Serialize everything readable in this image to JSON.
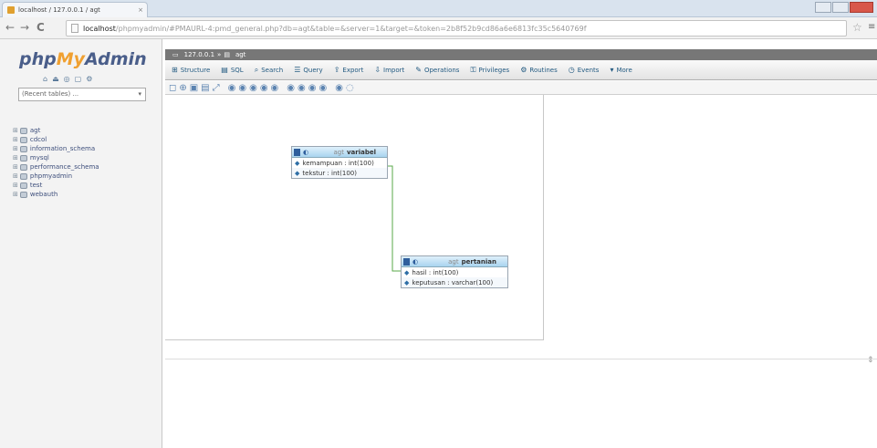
{
  "browser": {
    "tab_title": "localhost / 127.0.0.1 / agt",
    "tab_close": "×",
    "url_host": "localhost",
    "url_rest": "/phpmyadmin/#PMAURL-4:pmd_general.php?db=agt&table=&server=1&target=&token=2b8f52b9cd86a6e6813fc35c5640769f",
    "back": "←",
    "forward": "→",
    "reload": "C",
    "star": "☆",
    "menu": "≡"
  },
  "sidebar": {
    "logo_php": "php",
    "logo_my": "My",
    "logo_admin": "Admin",
    "quick_icons": [
      "home-icon",
      "exit-icon",
      "help-icon",
      "docs-icon",
      "settings-icon"
    ],
    "recent_label": "(Recent tables) ...",
    "databases": [
      {
        "label": "agt"
      },
      {
        "label": "cdcol"
      },
      {
        "label": "information_schema"
      },
      {
        "label": "mysql"
      },
      {
        "label": "performance_schema"
      },
      {
        "label": "phpmyadmin"
      },
      {
        "label": "test"
      },
      {
        "label": "webauth"
      }
    ]
  },
  "breadcrumb": {
    "server": "127.0.0.1",
    "database": "agt"
  },
  "top_menu": [
    {
      "label": "Structure",
      "icon": "structure-icon",
      "glyph": "⊞"
    },
    {
      "label": "SQL",
      "icon": "sql-icon",
      "glyph": "▤"
    },
    {
      "label": "Search",
      "icon": "search-icon",
      "glyph": "⌕"
    },
    {
      "label": "Query",
      "icon": "query-icon",
      "glyph": "☰"
    },
    {
      "label": "Export",
      "icon": "export-icon",
      "glyph": "⇪"
    },
    {
      "label": "Import",
      "icon": "import-icon",
      "glyph": "⇩"
    },
    {
      "label": "Operations",
      "icon": "operations-icon",
      "glyph": "✎"
    },
    {
      "label": "Privileges",
      "icon": "privileges-icon",
      "glyph": "⚿"
    },
    {
      "label": "Routines",
      "icon": "routines-icon",
      "glyph": "⚙"
    },
    {
      "label": "Events",
      "icon": "events-icon",
      "glyph": "◷"
    },
    {
      "label": "More",
      "icon": "more-icon",
      "glyph": "▾"
    }
  ],
  "designer_toolbar": [
    "◻",
    "⊕",
    "▣",
    "▤",
    "⤢",
    "◉",
    "◉",
    "◉",
    "◉",
    "◉",
    "◉",
    "◉",
    "◉",
    "◉",
    "◉",
    "◌"
  ],
  "tables": [
    {
      "schema": "agt",
      "name": "variabel",
      "columns": [
        {
          "name": "kemampuan",
          "type": "int(100)"
        },
        {
          "name": "tekstur",
          "type": "int(100)"
        }
      ]
    },
    {
      "schema": "agt",
      "name": "pertanian",
      "columns": [
        {
          "name": "hasil",
          "type": "int(100)"
        },
        {
          "name": "keputusan",
          "type": "varchar(100)"
        }
      ]
    }
  ],
  "colors": {
    "logo_blue": "#4a5e8a",
    "logo_orange": "#f0a030",
    "relation_line": "#5aa84a",
    "link_blue": "#235a81"
  }
}
